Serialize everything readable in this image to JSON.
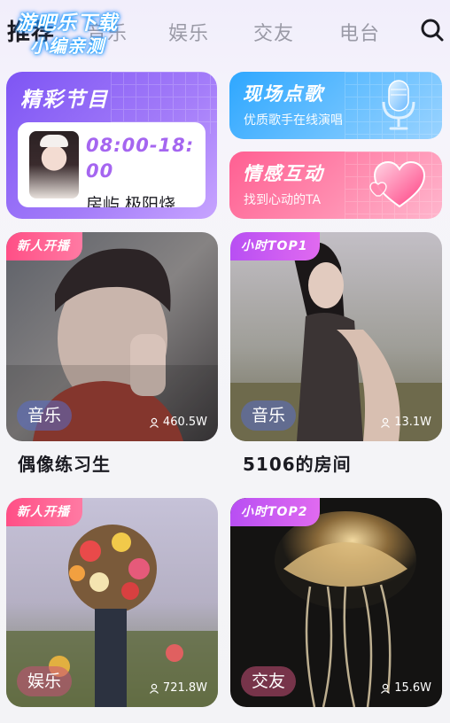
{
  "nav": {
    "tabs": [
      {
        "label": "推荐"
      },
      {
        "label": "音乐"
      },
      {
        "label": "娱乐"
      },
      {
        "label": "交友"
      },
      {
        "label": "电台"
      }
    ],
    "search_icon": "search-icon"
  },
  "watermark": {
    "line1": "游吧乐下载",
    "line2": "小编亲测"
  },
  "program_card": {
    "title": "精彩节目",
    "time": "08:00-18:00",
    "name": "房屿 极阳烧"
  },
  "song_card": {
    "title": "现场点歌",
    "subtitle": "优质歌手在线演唱",
    "icon": "microphone-icon"
  },
  "emotion_card": {
    "title": "情感互动",
    "subtitle": "找到心动的TA",
    "icon": "heart-icon"
  },
  "rooms": [
    {
      "badge": "新人开播",
      "category": "音乐",
      "count": "460.5W",
      "name": "偶像练习生"
    },
    {
      "badge": "小时TOP1",
      "category": "音乐",
      "count": "13.1W",
      "name": "5106的房间"
    },
    {
      "badge": "新人开播",
      "category": "娱乐",
      "count": "721.8W",
      "name": ""
    },
    {
      "badge": "小时TOP2",
      "category": "交友",
      "count": "15.6W",
      "name": ""
    }
  ],
  "colors": {
    "program_accent": "#a566f0",
    "song_card": "#2ea7ff",
    "emotion_card": "#ff5f92",
    "badge_new": "#ff4f86",
    "badge_top": "#b84ff3"
  }
}
